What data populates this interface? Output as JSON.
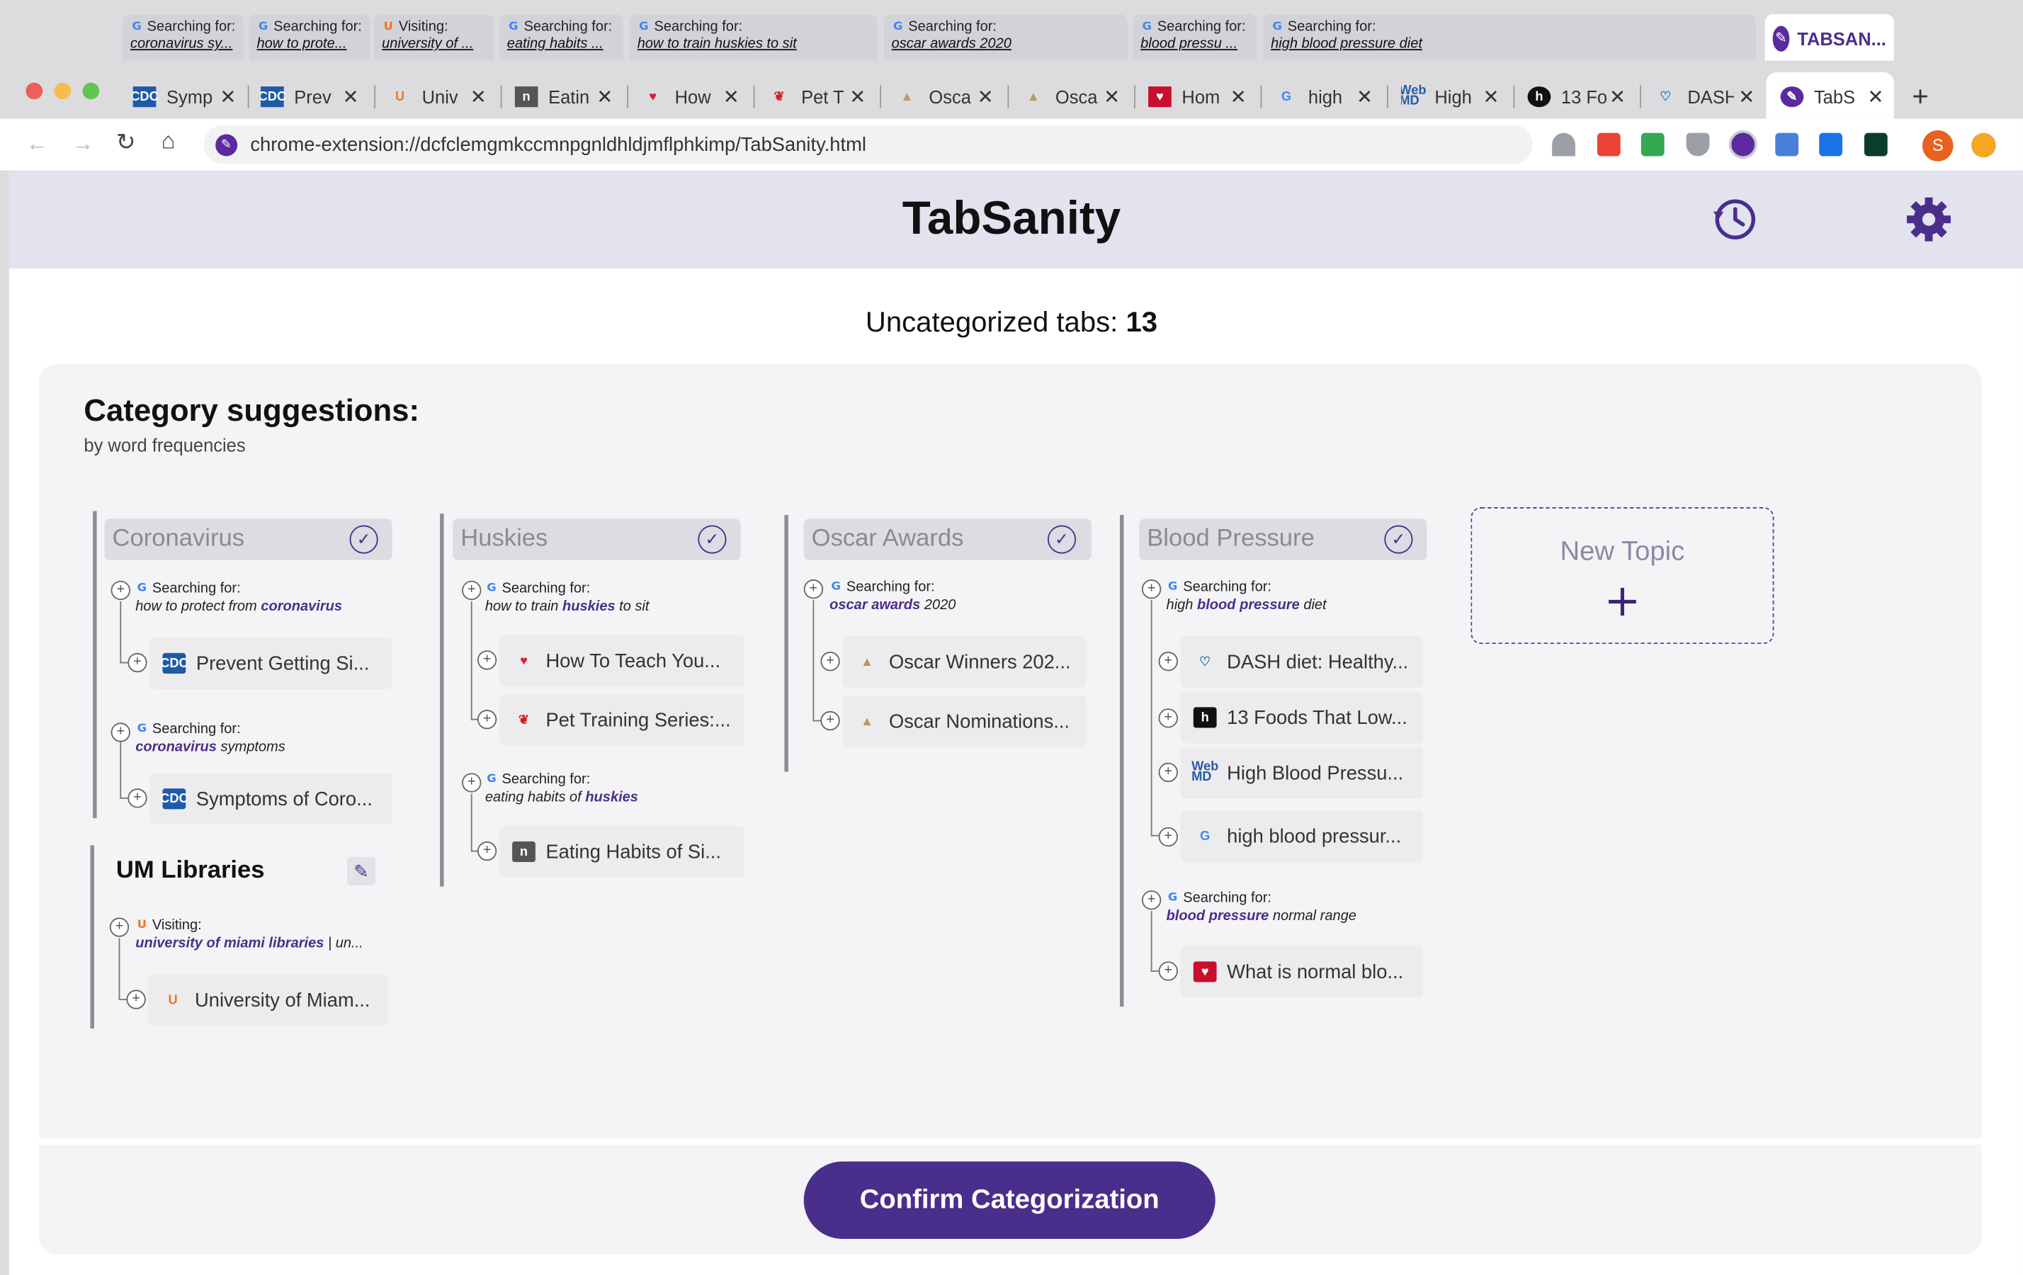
{
  "group_tabs": [
    {
      "kind": "Searching for:",
      "query": "coronavirus sy..."
    },
    {
      "kind": "Searching for:",
      "query": "how to prote..."
    },
    {
      "kind": "Visiting:",
      "query": "university of ..."
    },
    {
      "kind": "Searching for:",
      "query": "eating habits ..."
    },
    {
      "kind": "Searching for:",
      "query": "how to train huskies to sit"
    },
    {
      "kind": "Searching for:",
      "query": "oscar awards 2020"
    },
    {
      "kind": "Searching for:",
      "query": "blood pressu ..."
    },
    {
      "kind": "Searching for:",
      "query": "high blood pressure diet"
    }
  ],
  "group_tab_active": "TABSAN...",
  "browser_tabs": [
    {
      "icon": "cdc-icon",
      "title": "Symp"
    },
    {
      "icon": "cdc-icon",
      "title": "Prev"
    },
    {
      "icon": "um-icon",
      "title": "Univ"
    },
    {
      "icon": "n-icon",
      "title": "Eatin"
    },
    {
      "icon": "heart-icon",
      "title": "How"
    },
    {
      "icon": "paw-icon",
      "title": "Pet T"
    },
    {
      "icon": "oscar-icon",
      "title": "Osca"
    },
    {
      "icon": "oscar-icon",
      "title": "Osca"
    },
    {
      "icon": "aha-icon",
      "title": "Hom"
    },
    {
      "icon": "google-icon",
      "title": "high"
    },
    {
      "icon": "webmd-icon",
      "title": "High"
    },
    {
      "icon": "13-icon",
      "title": "13 Fo"
    },
    {
      "icon": "dash-icon",
      "title": "DASH"
    },
    {
      "icon": "tabsanity-icon",
      "title": "TabS",
      "active": true
    }
  ],
  "url": "chrome-extension://dcfclemgmkccmnpgnldhldjmflphkimp/TabSanity.html",
  "profile_initial": "S",
  "app_title": "TabSanity",
  "uncategorized_label": "Uncategorized tabs:",
  "uncategorized_count": "13",
  "suggestions_title": "Category suggestions:",
  "suggestions_subtitle": "by word frequencies",
  "searching_label": "Searching for:",
  "visiting_label": "Visiting:",
  "categories": {
    "coronavirus": {
      "name": "Coronavirus",
      "q1_pre": "how to protect from ",
      "q1_kw": "coronavirus",
      "q1_post": "",
      "i1": "Prevent Getting Si...",
      "q2_pre": "",
      "q2_kw": "coronavirus",
      "q2_post": " symptoms",
      "i2": "Symptoms of Coro..."
    },
    "um": {
      "name": "UM Libraries",
      "q1_kw": "university of miami libraries",
      "q1_post": " | un...",
      "i1": "University of Miam..."
    },
    "huskies": {
      "name": "Huskies",
      "q1_pre": "how to train ",
      "q1_kw": "huskies",
      "q1_post": " to sit",
      "i1": "How To Teach You...",
      "i2": "Pet Training Series:...",
      "q2_pre": "eating habits of ",
      "q2_kw": "huskies",
      "q2_post": "",
      "i3": "Eating Habits of Si..."
    },
    "oscar": {
      "name": "Oscar Awards",
      "q1_kw": "oscar awards",
      "q1_post": " 2020",
      "i1": "Oscar Winners 202...",
      "i2": "Oscar Nominations..."
    },
    "blood": {
      "name": "Blood Pressure",
      "q1_pre": "high ",
      "q1_kw": "blood pressure",
      "q1_post": " diet",
      "i1": "DASH diet: Healthy...",
      "i2": "13 Foods That Low...",
      "i3": "High Blood Pressu...",
      "i4": "high blood pressur...",
      "q2_kw": "blood pressure",
      "q2_post": " normal range",
      "i5": "What is normal blo..."
    }
  },
  "new_topic_label": "New Topic",
  "confirm_label": "Confirm Categorization",
  "colors": {
    "accent": "#4a2e8c",
    "header_bg": "#e3e3f0"
  }
}
